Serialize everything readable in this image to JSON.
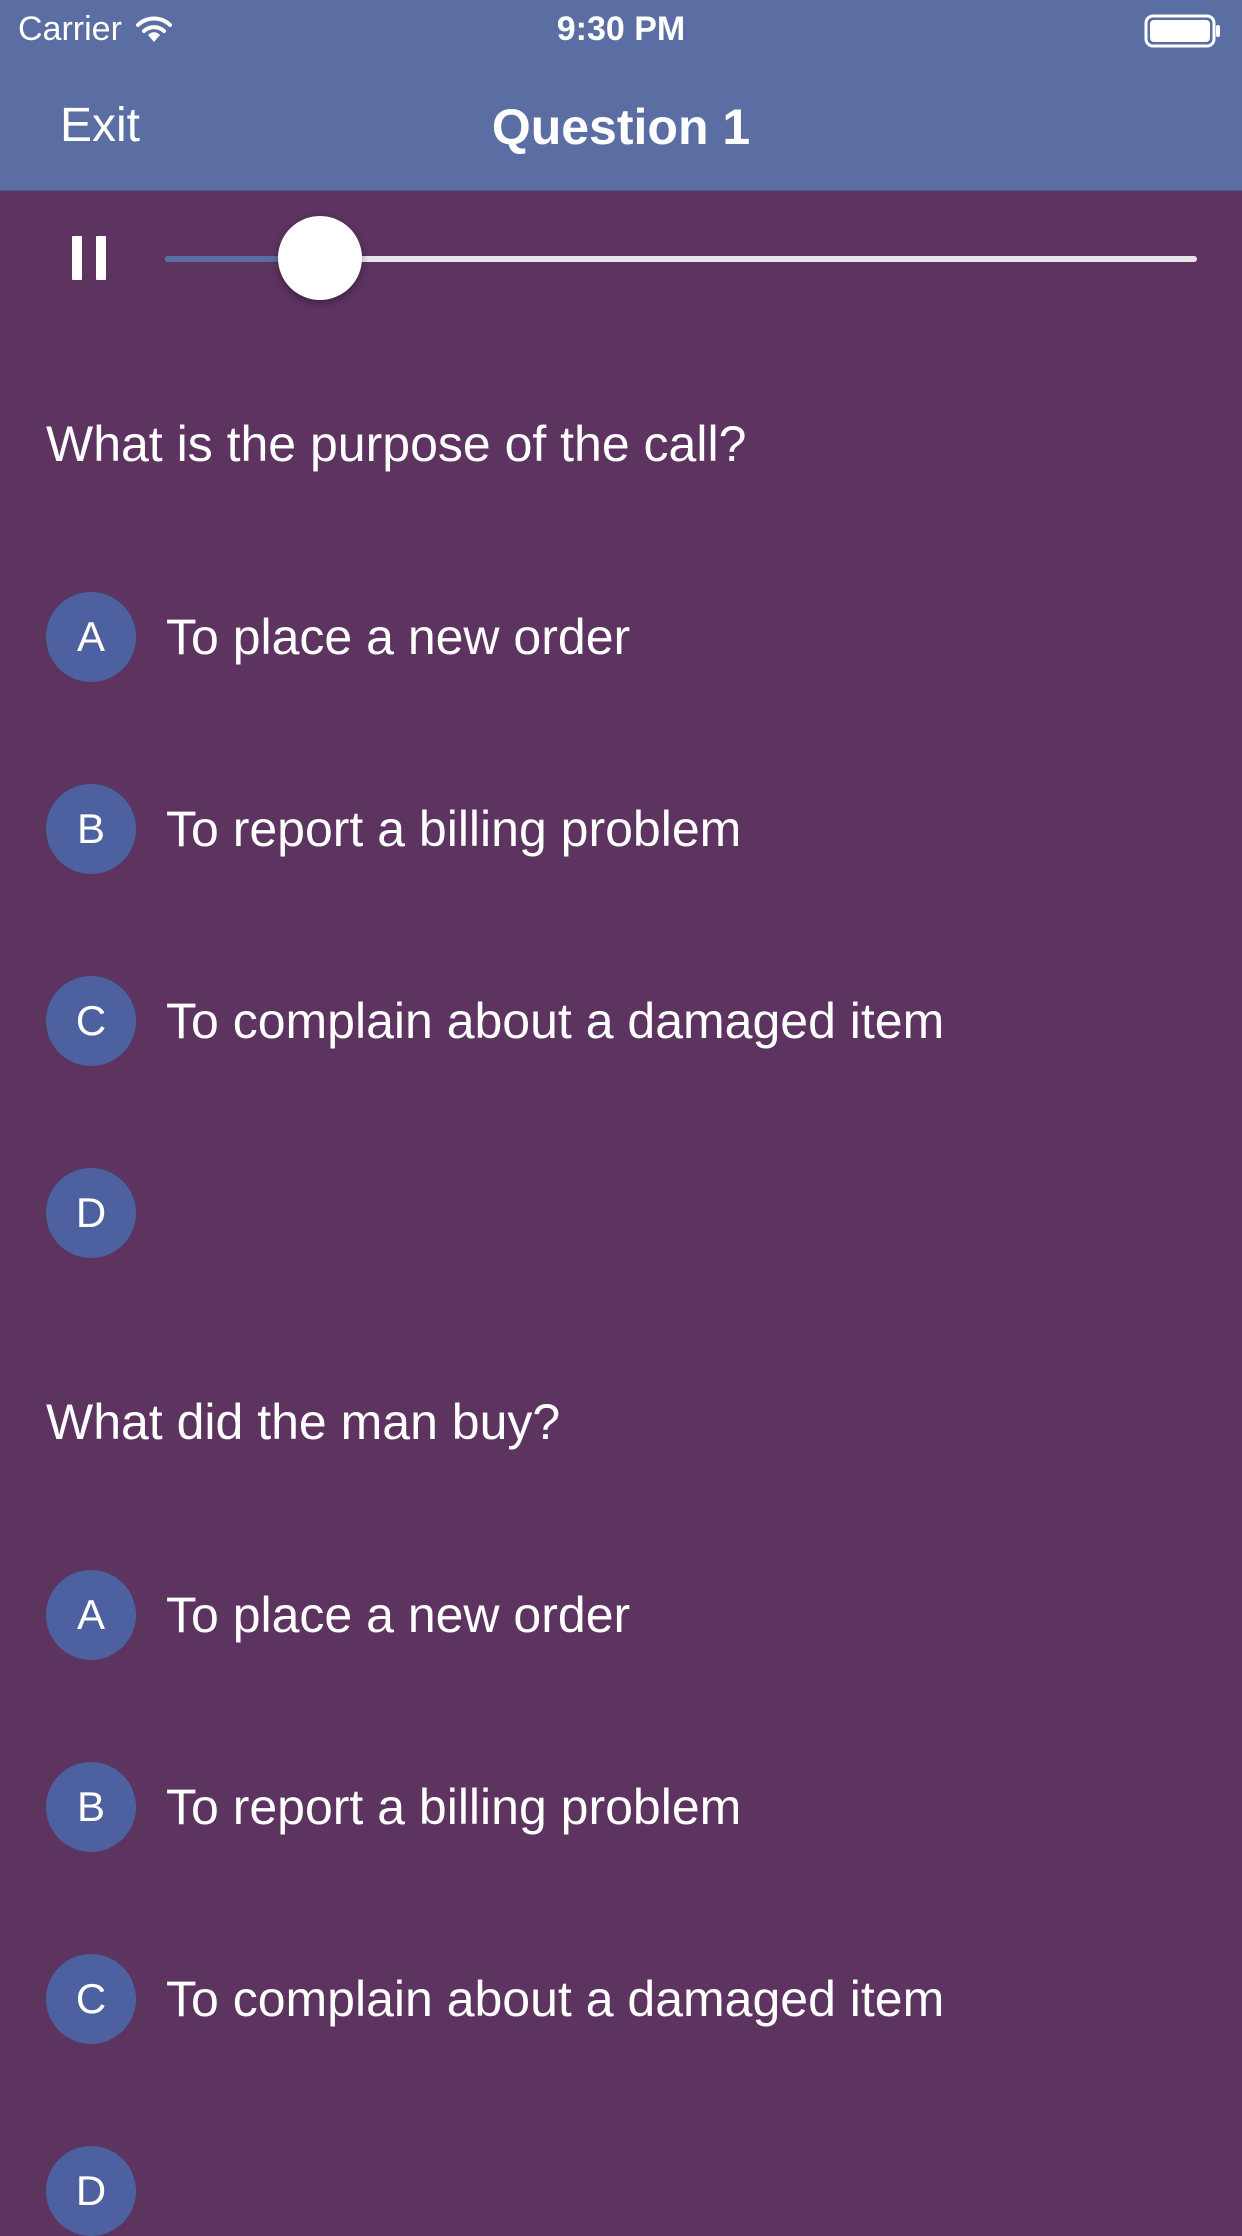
{
  "status_bar": {
    "carrier": "Carrier",
    "time": "9:30 PM"
  },
  "nav": {
    "exit_label": "Exit",
    "title": "Question 1"
  },
  "player": {
    "progress": 0.15
  },
  "questions": [
    {
      "text": "What is the purpose of the call?",
      "options": [
        {
          "letter": "A",
          "text": "To place a new order"
        },
        {
          "letter": "B",
          "text": "To report a billing problem"
        },
        {
          "letter": "C",
          "text": "To complain about a damaged item"
        },
        {
          "letter": "D",
          "text": ""
        }
      ]
    },
    {
      "text": "What did the man buy?",
      "options": [
        {
          "letter": "A",
          "text": "To place a new order"
        },
        {
          "letter": "B",
          "text": "To report a billing problem"
        },
        {
          "letter": "C",
          "text": "To complain about a damaged item"
        },
        {
          "letter": "D",
          "text": ""
        }
      ]
    }
  ],
  "colors": {
    "nav_background": "#5b6ea3",
    "page_background": "#5d3360",
    "badge": "#4d61a0"
  }
}
